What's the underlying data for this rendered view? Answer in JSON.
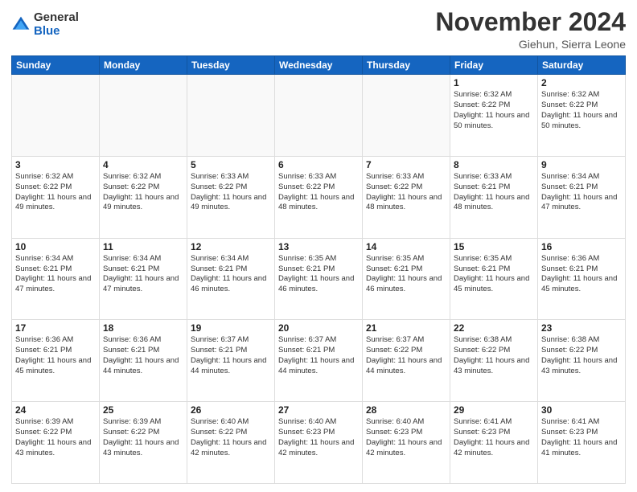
{
  "logo": {
    "general": "General",
    "blue": "Blue"
  },
  "header": {
    "month_title": "November 2024",
    "location": "Giehun, Sierra Leone"
  },
  "weekdays": [
    "Sunday",
    "Monday",
    "Tuesday",
    "Wednesday",
    "Thursday",
    "Friday",
    "Saturday"
  ],
  "weeks": [
    [
      {
        "day": "",
        "info": ""
      },
      {
        "day": "",
        "info": ""
      },
      {
        "day": "",
        "info": ""
      },
      {
        "day": "",
        "info": ""
      },
      {
        "day": "",
        "info": ""
      },
      {
        "day": "1",
        "info": "Sunrise: 6:32 AM\nSunset: 6:22 PM\nDaylight: 11 hours\nand 50 minutes."
      },
      {
        "day": "2",
        "info": "Sunrise: 6:32 AM\nSunset: 6:22 PM\nDaylight: 11 hours\nand 50 minutes."
      }
    ],
    [
      {
        "day": "3",
        "info": "Sunrise: 6:32 AM\nSunset: 6:22 PM\nDaylight: 11 hours\nand 49 minutes."
      },
      {
        "day": "4",
        "info": "Sunrise: 6:32 AM\nSunset: 6:22 PM\nDaylight: 11 hours\nand 49 minutes."
      },
      {
        "day": "5",
        "info": "Sunrise: 6:33 AM\nSunset: 6:22 PM\nDaylight: 11 hours\nand 49 minutes."
      },
      {
        "day": "6",
        "info": "Sunrise: 6:33 AM\nSunset: 6:22 PM\nDaylight: 11 hours\nand 48 minutes."
      },
      {
        "day": "7",
        "info": "Sunrise: 6:33 AM\nSunset: 6:22 PM\nDaylight: 11 hours\nand 48 minutes."
      },
      {
        "day": "8",
        "info": "Sunrise: 6:33 AM\nSunset: 6:21 PM\nDaylight: 11 hours\nand 48 minutes."
      },
      {
        "day": "9",
        "info": "Sunrise: 6:34 AM\nSunset: 6:21 PM\nDaylight: 11 hours\nand 47 minutes."
      }
    ],
    [
      {
        "day": "10",
        "info": "Sunrise: 6:34 AM\nSunset: 6:21 PM\nDaylight: 11 hours\nand 47 minutes."
      },
      {
        "day": "11",
        "info": "Sunrise: 6:34 AM\nSunset: 6:21 PM\nDaylight: 11 hours\nand 47 minutes."
      },
      {
        "day": "12",
        "info": "Sunrise: 6:34 AM\nSunset: 6:21 PM\nDaylight: 11 hours\nand 46 minutes."
      },
      {
        "day": "13",
        "info": "Sunrise: 6:35 AM\nSunset: 6:21 PM\nDaylight: 11 hours\nand 46 minutes."
      },
      {
        "day": "14",
        "info": "Sunrise: 6:35 AM\nSunset: 6:21 PM\nDaylight: 11 hours\nand 46 minutes."
      },
      {
        "day": "15",
        "info": "Sunrise: 6:35 AM\nSunset: 6:21 PM\nDaylight: 11 hours\nand 45 minutes."
      },
      {
        "day": "16",
        "info": "Sunrise: 6:36 AM\nSunset: 6:21 PM\nDaylight: 11 hours\nand 45 minutes."
      }
    ],
    [
      {
        "day": "17",
        "info": "Sunrise: 6:36 AM\nSunset: 6:21 PM\nDaylight: 11 hours\nand 45 minutes."
      },
      {
        "day": "18",
        "info": "Sunrise: 6:36 AM\nSunset: 6:21 PM\nDaylight: 11 hours\nand 44 minutes."
      },
      {
        "day": "19",
        "info": "Sunrise: 6:37 AM\nSunset: 6:21 PM\nDaylight: 11 hours\nand 44 minutes."
      },
      {
        "day": "20",
        "info": "Sunrise: 6:37 AM\nSunset: 6:21 PM\nDaylight: 11 hours\nand 44 minutes."
      },
      {
        "day": "21",
        "info": "Sunrise: 6:37 AM\nSunset: 6:22 PM\nDaylight: 11 hours\nand 44 minutes."
      },
      {
        "day": "22",
        "info": "Sunrise: 6:38 AM\nSunset: 6:22 PM\nDaylight: 11 hours\nand 43 minutes."
      },
      {
        "day": "23",
        "info": "Sunrise: 6:38 AM\nSunset: 6:22 PM\nDaylight: 11 hours\nand 43 minutes."
      }
    ],
    [
      {
        "day": "24",
        "info": "Sunrise: 6:39 AM\nSunset: 6:22 PM\nDaylight: 11 hours\nand 43 minutes."
      },
      {
        "day": "25",
        "info": "Sunrise: 6:39 AM\nSunset: 6:22 PM\nDaylight: 11 hours\nand 43 minutes."
      },
      {
        "day": "26",
        "info": "Sunrise: 6:40 AM\nSunset: 6:22 PM\nDaylight: 11 hours\nand 42 minutes."
      },
      {
        "day": "27",
        "info": "Sunrise: 6:40 AM\nSunset: 6:23 PM\nDaylight: 11 hours\nand 42 minutes."
      },
      {
        "day": "28",
        "info": "Sunrise: 6:40 AM\nSunset: 6:23 PM\nDaylight: 11 hours\nand 42 minutes."
      },
      {
        "day": "29",
        "info": "Sunrise: 6:41 AM\nSunset: 6:23 PM\nDaylight: 11 hours\nand 42 minutes."
      },
      {
        "day": "30",
        "info": "Sunrise: 6:41 AM\nSunset: 6:23 PM\nDaylight: 11 hours\nand 41 minutes."
      }
    ]
  ]
}
